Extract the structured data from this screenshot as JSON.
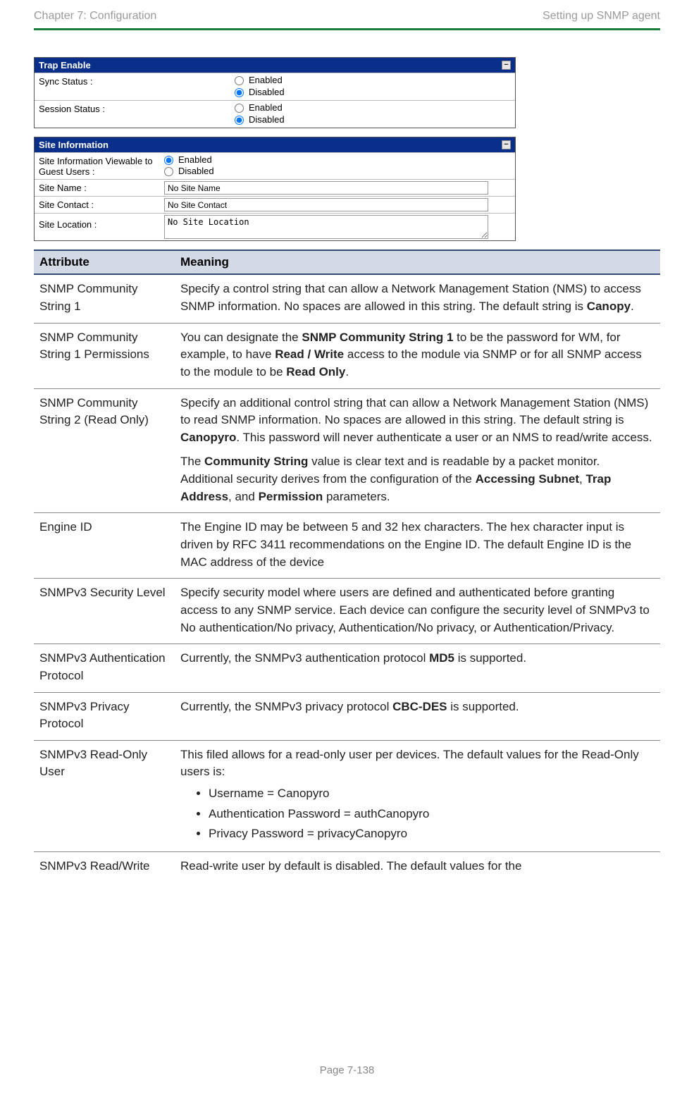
{
  "header": {
    "left": "Chapter 7:  Configuration",
    "right": "Setting up SNMP agent"
  },
  "panels": {
    "trapEnable": {
      "title": "Trap Enable",
      "syncStatusLabel": "Sync Status :",
      "sessionStatusLabel": "Session Status :",
      "enabled": "Enabled",
      "disabled": "Disabled"
    },
    "siteInfo": {
      "title": "Site Information",
      "viewableLabel": "Site Information Viewable to Guest Users :",
      "enabled": "Enabled",
      "disabled": "Disabled",
      "siteNameLabel": "Site Name :",
      "siteNameValue": "No Site Name",
      "siteContactLabel": "Site Contact :",
      "siteContactValue": "No Site Contact",
      "siteLocationLabel": "Site Location :",
      "siteLocationValue": "No Site Location"
    }
  },
  "table": {
    "headers": {
      "attribute": "Attribute",
      "meaning": "Meaning"
    },
    "rows": [
      {
        "attr": "SNMP Community String 1",
        "meaning_pre": "Specify a control string that can allow a Network Management Station (NMS) to access SNMP information. No spaces are allowed in this string. The default string is ",
        "bold1": "Canopy",
        "meaning_post": "."
      },
      {
        "attr": "SNMP Community String 1 Permissions",
        "p1_a": "You can designate the ",
        "p1_b": "SNMP Community String 1",
        "p1_c": " to be the password for WM, for example, to have ",
        "p1_d": "Read / Write",
        "p1_e": " access to the module via SNMP or for all SNMP access to the module to be ",
        "p1_f": "Read Only",
        "p1_g": "."
      },
      {
        "attr": "SNMP Community String 2 (Read Only)",
        "p1_a": "Specify an additional control string that can allow a Network Management Station (NMS) to read SNMP information. No spaces are allowed in this string. The default string is ",
        "p1_b": "Canopyro",
        "p1_c": ". This password will never authenticate a user or an NMS to read/write access.",
        "p2_a": "The ",
        "p2_b": "Community String",
        "p2_c": " value is clear text and is readable by a packet monitor. Additional security derives from the configuration of the ",
        "p2_d": "Accessing Subnet",
        "p2_e": ", ",
        "p2_f": "Trap Address",
        "p2_g": ", and ",
        "p2_h": "Permission",
        "p2_i": " parameters."
      },
      {
        "attr": "Engine ID",
        "meaning": "The Engine ID may be between 5 and 32 hex characters. The hex character input is driven by RFC 3411 recommendations on the Engine ID. The default Engine ID is the MAC address of the device"
      },
      {
        "attr": "SNMPv3 Security Level",
        "meaning": "Specify security model where users are defined and authenticated before granting access to any SNMP service. Each device can configure the security level of SNMPv3 to No authentication/No privacy, Authentication/No privacy, or Authentication/Privacy."
      },
      {
        "attr": "SNMPv3 Authentication Protocol",
        "p1_a": "Currently, the SNMPv3 authentication protocol ",
        "p1_b": "MD5",
        "p1_c": " is supported."
      },
      {
        "attr": "SNMPv3 Privacy Protocol",
        "p1_a": "Currently, the SNMPv3 privacy protocol ",
        "p1_b": "CBC-DES",
        "p1_c": " is supported."
      },
      {
        "attr": "SNMPv3 Read-Only User",
        "intro": "This filed allows for a read-only user per devices. The default values for the Read-Only users is:",
        "bullets": [
          "Username = Canopyro",
          "Authentication Password = authCanopyro",
          "Privacy Password = privacyCanopyro"
        ]
      },
      {
        "attr": "SNMPv3 Read/Write",
        "meaning": "Read-write user by default is disabled. The default values for the"
      }
    ]
  },
  "footer": "Page 7-138"
}
